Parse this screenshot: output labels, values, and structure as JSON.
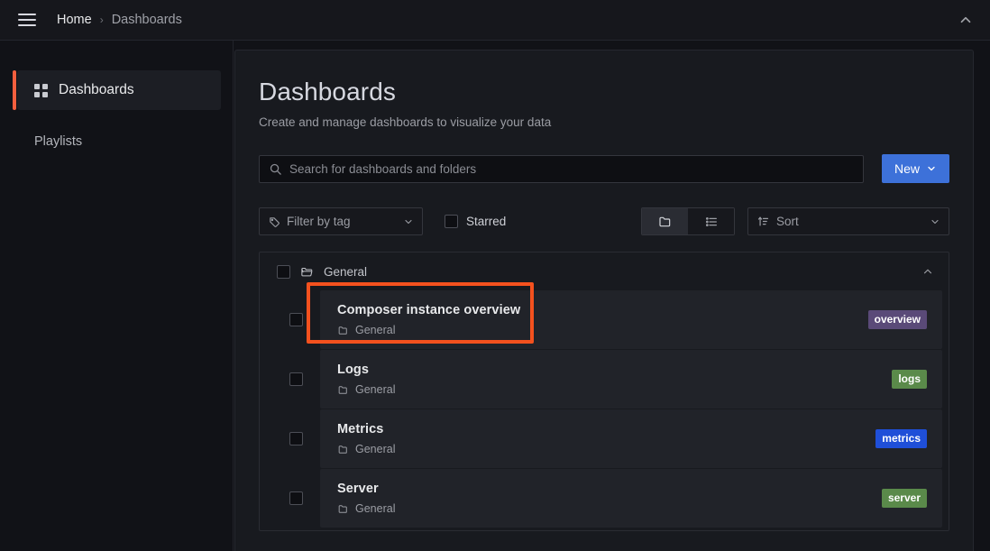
{
  "topbar": {
    "menu_icon": "hamburger-icon",
    "breadcrumb": {
      "home": "Home",
      "separator": "›",
      "current": "Dashboards"
    },
    "collapse_icon": "chevron-up-icon"
  },
  "sidebar": {
    "items": [
      {
        "label": "Dashboards",
        "icon": "grid-icon",
        "active": true
      },
      {
        "label": "Playlists",
        "icon": "",
        "active": false
      }
    ],
    "accent_color": "#f55f3e"
  },
  "main": {
    "title": "Dashboards",
    "subtitle": "Create and manage dashboards to visualize your data",
    "search": {
      "placeholder": "Search for dashboards and folders",
      "value": "",
      "icon": "search-icon"
    },
    "new_button": {
      "label": "New",
      "icon": "chevron-down-icon",
      "color": "#3d71d9"
    },
    "filters": {
      "tag_filter": {
        "label": "Filter by tag",
        "icon": "tag-icon",
        "chevron": "chevron-down-icon"
      },
      "starred": {
        "label": "Starred",
        "checked": false
      },
      "view_toggle": {
        "options": [
          {
            "name": "folder-view",
            "icon": "folder-icon",
            "active": true
          },
          {
            "name": "list-view",
            "icon": "list-icon",
            "active": false
          }
        ]
      },
      "sort": {
        "label": "Sort",
        "icon": "sort-amount-icon",
        "chevron": "chevron-down-icon"
      }
    },
    "results": {
      "folder": {
        "name": "General",
        "icon": "folder-open-icon",
        "checked": false,
        "expanded": true,
        "caret": "chevron-up-icon"
      },
      "rows": [
        {
          "title": "Composer instance overview",
          "location": "General",
          "location_icon": "folder-icon",
          "tag": "overview",
          "tag_color": "#5a4a78",
          "checked": false,
          "highlighted": true
        },
        {
          "title": "Logs",
          "location": "General",
          "location_icon": "folder-icon",
          "tag": "logs",
          "tag_color": "#5a8a4a",
          "checked": false,
          "highlighted": false
        },
        {
          "title": "Metrics",
          "location": "General",
          "location_icon": "folder-icon",
          "tag": "metrics",
          "tag_color": "#1f4fd8",
          "checked": false,
          "highlighted": false
        },
        {
          "title": "Server",
          "location": "General",
          "location_icon": "folder-icon",
          "tag": "server",
          "tag_color": "#5a8a4a",
          "checked": false,
          "highlighted": false
        }
      ]
    }
  },
  "annotation": {
    "color": "#f4511e",
    "target": "Composer instance overview"
  }
}
